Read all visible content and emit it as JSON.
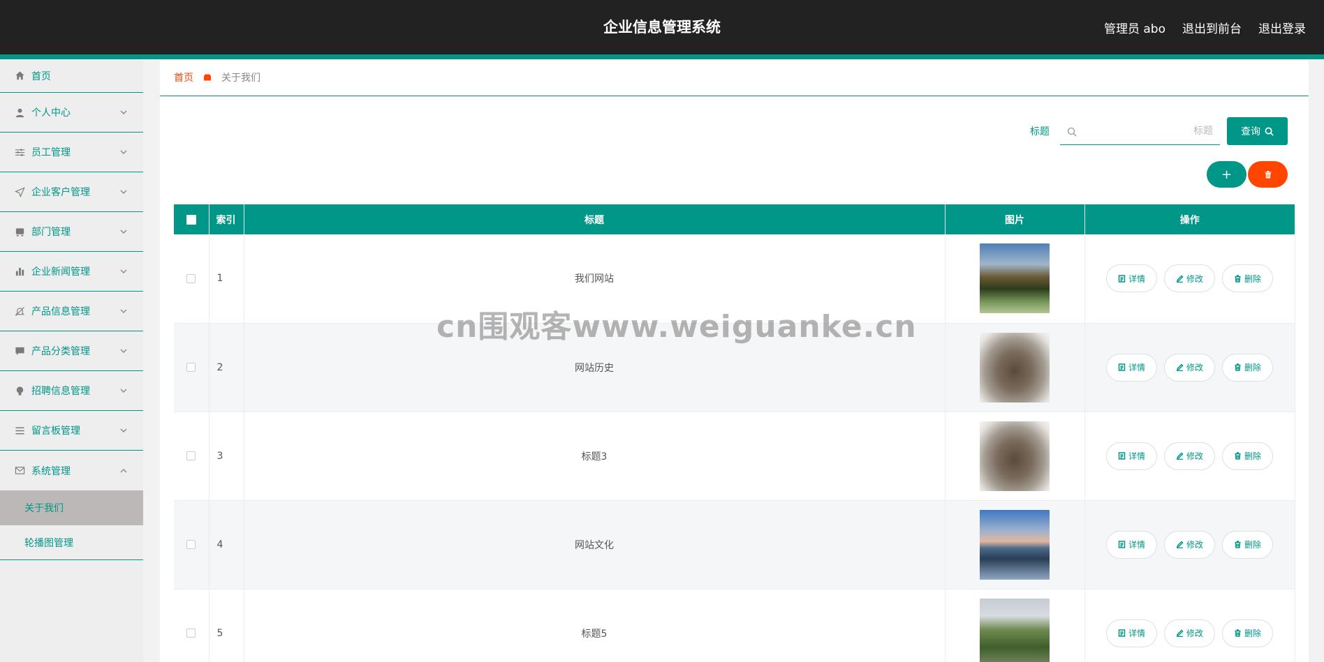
{
  "header": {
    "title": "企业信息管理系统",
    "user": "管理员 abo",
    "to_front": "退出到前台",
    "logout": "退出登录"
  },
  "sidebar": {
    "items": [
      {
        "label": "首页",
        "icon": "home-icon"
      },
      {
        "label": "个人中心",
        "icon": "user-icon"
      },
      {
        "label": "员工管理",
        "icon": "sliders-icon"
      },
      {
        "label": "企业客户管理",
        "icon": "send-icon"
      },
      {
        "label": "部门管理",
        "icon": "box-icon"
      },
      {
        "label": "企业新闻管理",
        "icon": "bar-chart-icon"
      },
      {
        "label": "产品信息管理",
        "icon": "bell-off-icon"
      },
      {
        "label": "产品分类管理",
        "icon": "chat-icon"
      },
      {
        "label": "招聘信息管理",
        "icon": "bulb-icon"
      },
      {
        "label": "留言板管理",
        "icon": "list-icon"
      },
      {
        "label": "系统管理",
        "icon": "mail-icon"
      }
    ],
    "sub_items": [
      {
        "label": "关于我们",
        "active": true
      },
      {
        "label": "轮播图管理",
        "active": false
      }
    ]
  },
  "breadcrumb": {
    "home": "首页",
    "current": "关于我们"
  },
  "search": {
    "label": "标题",
    "placeholder": "标题",
    "button": "查询"
  },
  "actions": {
    "add": "+"
  },
  "table": {
    "columns": [
      "索引",
      "标题",
      "图片",
      "操作"
    ],
    "rows": [
      {
        "index": "1",
        "title": "我们网站"
      },
      {
        "index": "2",
        "title": "网站历史"
      },
      {
        "index": "3",
        "title": "标题3"
      },
      {
        "index": "4",
        "title": "网站文化"
      },
      {
        "index": "5",
        "title": "标题5"
      }
    ],
    "ops": {
      "detail": "详情",
      "edit": "修改",
      "delete": "删除"
    }
  },
  "watermark": "cn围观客www.weiguanke.cn",
  "colors": {
    "primary": "#009688",
    "danger": "#ff4500",
    "header_bg": "#222222"
  }
}
